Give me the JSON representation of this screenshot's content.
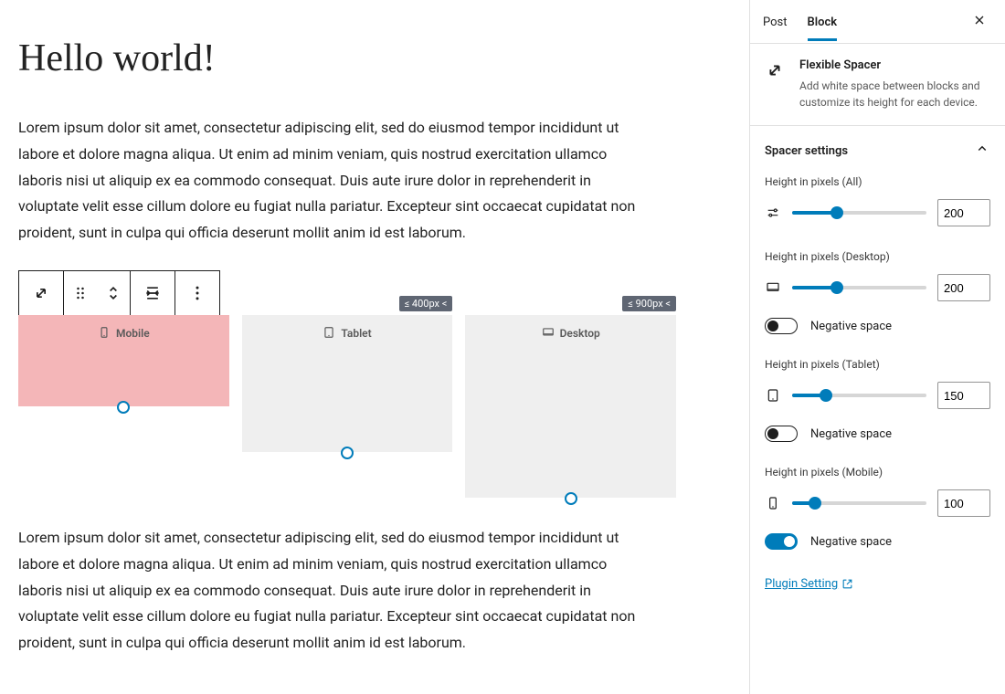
{
  "post": {
    "title": "Hello world!",
    "paragraph": "Lorem ipsum dolor sit amet, consectetur adipiscing elit, sed do eiusmod tempor incididunt ut labore et dolore magna aliqua. Ut enim ad minim veniam, quis nostrud exercitation ullamco laboris nisi ut aliquip ex ea commodo consequat. Duis aute irure dolor in reprehenderit in voluptate velit esse cillum dolore eu fugiat nulla pariatur. Excepteur sint occaecat cupidatat non proident, sunt in culpa qui officia deserunt mollit anim id est laborum."
  },
  "spacers": {
    "mobile_label": "Mobile",
    "tablet_label": "Tablet",
    "desktop_label": "Desktop",
    "badge_tablet": "≤ 400px <",
    "badge_desktop": "≤ 900px <"
  },
  "sidebar": {
    "tab_post": "Post",
    "tab_block": "Block",
    "block_title": "Flexible Spacer",
    "block_desc": "Add white space between blocks and customize its height for each device.",
    "panel_title": "Spacer settings",
    "controls": {
      "all": {
        "label": "Height in pixels (All)",
        "value": "200",
        "pct": 33
      },
      "desktop": {
        "label": "Height in pixels (Desktop)",
        "value": "200",
        "pct": 33,
        "negative_label": "Negative space",
        "negative_on": false
      },
      "tablet": {
        "label": "Height in pixels (Tablet)",
        "value": "150",
        "pct": 25,
        "negative_label": "Negative space",
        "negative_on": false
      },
      "mobile": {
        "label": "Height in pixels (Mobile)",
        "value": "100",
        "pct": 17,
        "negative_label": "Negative space",
        "negative_on": true
      }
    },
    "plugin_link": "Plugin Setting"
  }
}
